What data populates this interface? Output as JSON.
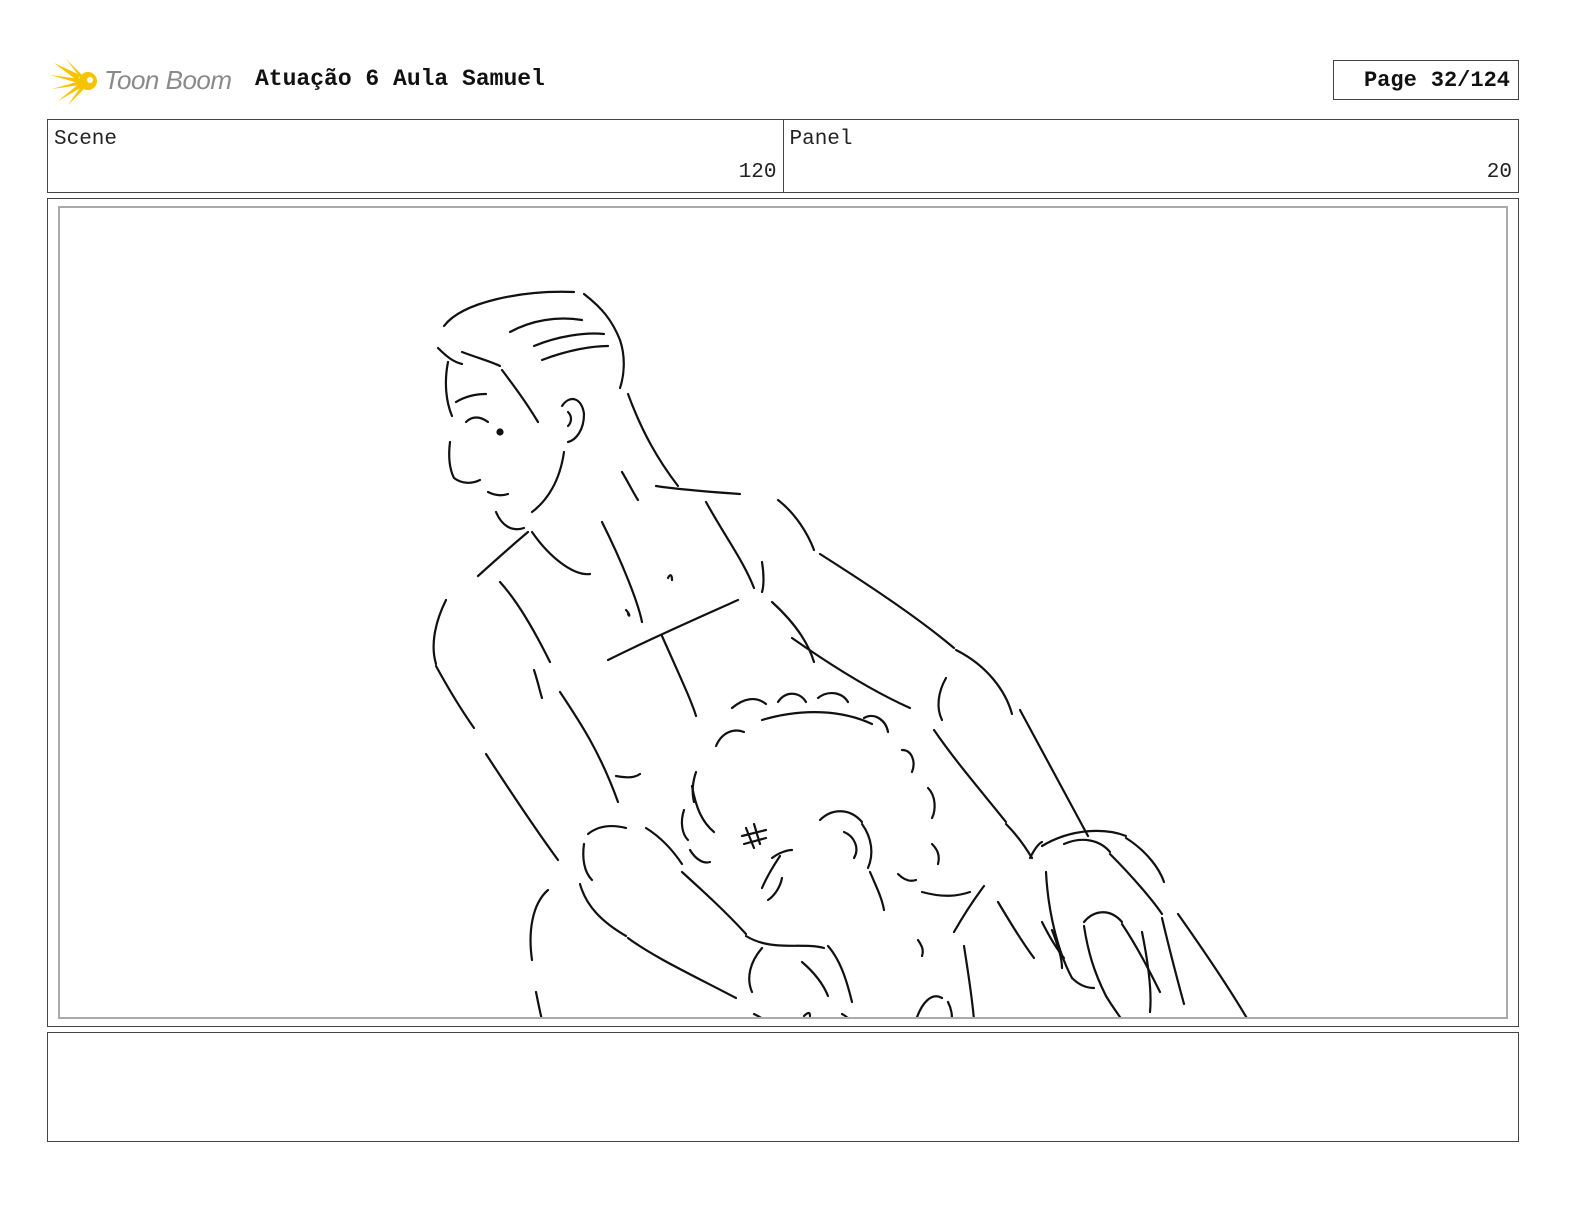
{
  "header": {
    "logo_text": "Toon Boom",
    "title": "Atuação 6 Aula Samuel",
    "page_label": "Page",
    "page_value": "32/124"
  },
  "info": {
    "scene_label": "Scene",
    "scene_value": "120",
    "panel_label": "Panel",
    "panel_value": "20"
  },
  "panel": {
    "drawing": "storyboard-sketch"
  },
  "notes": {
    "text": ""
  },
  "colors": {
    "logo_burst": "#f5c400",
    "logo_text": "#8a8a8a",
    "frame": "#444444",
    "inner_frame": "#aaaaaa"
  }
}
